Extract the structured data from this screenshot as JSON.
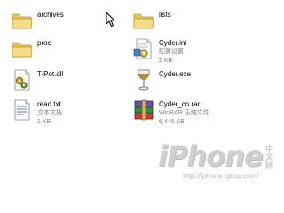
{
  "files": [
    {
      "id": "archives",
      "icon": "folder-icon",
      "name": "archives",
      "lines": []
    },
    {
      "id": "lists",
      "icon": "folder-icon",
      "name": "lists",
      "lines": []
    },
    {
      "id": "proc",
      "icon": "folder-icon",
      "name": "proc",
      "lines": []
    },
    {
      "id": "cyder-ini",
      "icon": "config-file-icon",
      "name": "Cyder.ini",
      "lines": [
        "配置设置",
        "2 KB"
      ]
    },
    {
      "id": "t-pot-dll",
      "icon": "dll-file-icon",
      "name": "T-Pot.dll",
      "lines": []
    },
    {
      "id": "cyder-exe",
      "icon": "wine-glass-icon",
      "name": "Cyder.exe",
      "lines": []
    },
    {
      "id": "read-txt",
      "icon": "text-file-icon",
      "name": "read.txt",
      "lines": [
        "文本文档",
        "1 KB"
      ]
    },
    {
      "id": "cyder-cn-rar",
      "icon": "rar-archive-icon",
      "name": "Cyder_cn.rar",
      "lines": [
        "WinRAR 压缩文件",
        "6,445 KB"
      ]
    }
  ],
  "watermark": {
    "logo_text": "iPhone",
    "cn_text": "中文网",
    "url": "http://iphone.tgbus.com/"
  }
}
